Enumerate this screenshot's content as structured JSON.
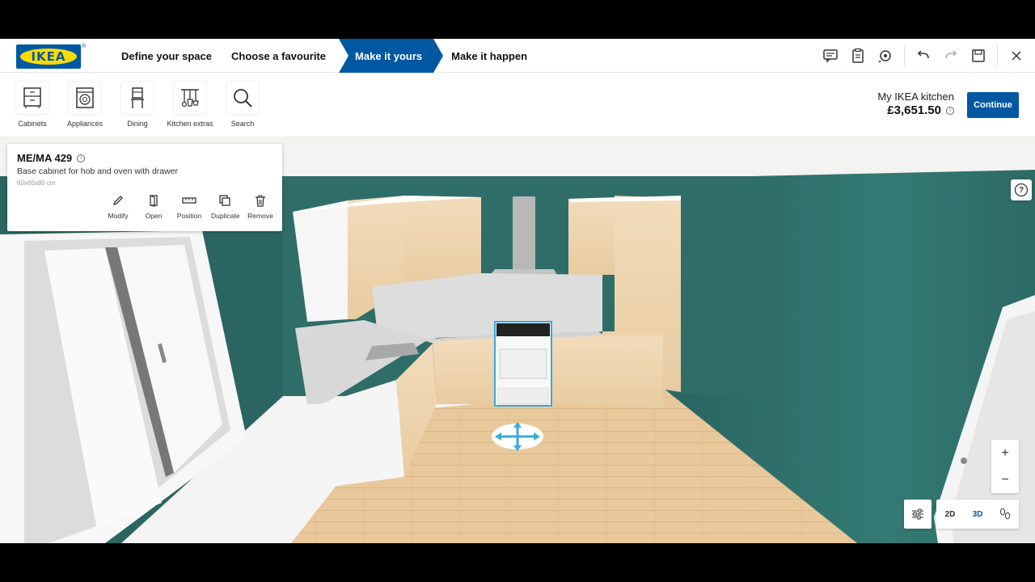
{
  "brand": {
    "logo_text": "IKEA",
    "reg": "®"
  },
  "steps": [
    {
      "label": "Define your space",
      "active": false
    },
    {
      "label": "Choose a favourite",
      "active": false
    },
    {
      "label": "Make it yours",
      "active": true
    },
    {
      "label": "Make it happen",
      "active": false
    }
  ],
  "topbar_icons": [
    "chat-icon",
    "clipboard-icon",
    "help-search-icon",
    "undo-icon",
    "redo-icon",
    "save-icon",
    "close-icon"
  ],
  "tools": [
    {
      "label": "Cabinets",
      "icon": "cabinet-icon"
    },
    {
      "label": "Appliances",
      "icon": "appliance-icon"
    },
    {
      "label": "Dining",
      "icon": "chair-icon"
    },
    {
      "label": "Kitchen extras",
      "icon": "utensils-icon"
    },
    {
      "label": "Search",
      "icon": "search-icon"
    }
  ],
  "summary": {
    "name": "My IKEA kitchen",
    "price": "£3,651.50",
    "continue_label": "Continue"
  },
  "selected_item": {
    "title": "ME/MA 429",
    "description": "Base cabinet for hob and oven with drawer",
    "dimensions": "60x60x80 cm",
    "actions": [
      {
        "label": "Modify",
        "icon": "pencil-icon"
      },
      {
        "label": "Open",
        "icon": "door-open-icon"
      },
      {
        "label": "Position",
        "icon": "ruler-icon"
      },
      {
        "label": "Duplicate",
        "icon": "duplicate-icon"
      },
      {
        "label": "Remove",
        "icon": "trash-icon"
      }
    ]
  },
  "view_controls": {
    "zoom_in": "+",
    "zoom_out": "−",
    "view_2d": "2D",
    "view_3d": "3D",
    "active_view": "3D"
  },
  "help": {
    "label": "?"
  },
  "colors": {
    "brand_blue": "#0058a3",
    "brand_yellow": "#ffdb00",
    "wall_teal": "#2e6b67",
    "wood": "#e8c99a"
  }
}
